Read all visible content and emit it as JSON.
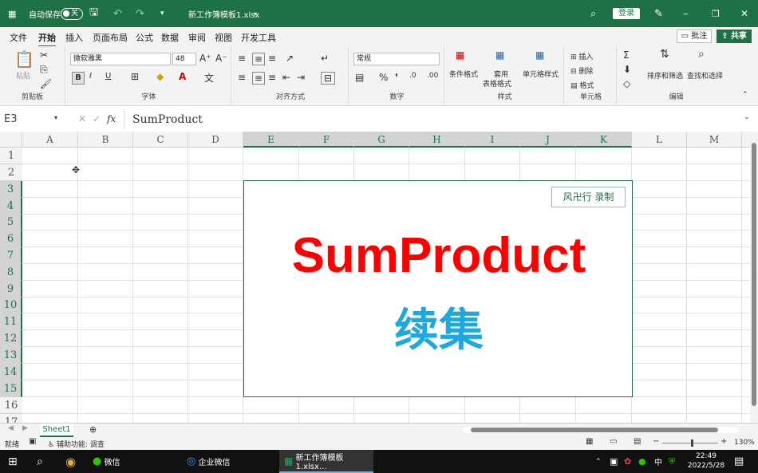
{
  "titlebar": {
    "autosave": "自动保存",
    "toggle": "关",
    "filename": "新工作簿模板1.xlsx",
    "login": "登录"
  },
  "menu": [
    "文件",
    "开始",
    "插入",
    "页面布局",
    "公式",
    "数据",
    "审阅",
    "视图",
    "开发工具"
  ],
  "comment_btn": "批注",
  "share_btn": "共享",
  "ribbon": {
    "clipboard": {
      "paste": "粘贴",
      "label": "剪贴板"
    },
    "font": {
      "name": "微软雅黑",
      "size": "48",
      "bold": "B",
      "italic": "I",
      "underline": "U",
      "label": "字体"
    },
    "align": {
      "label": "对齐方式"
    },
    "number": {
      "format": "常规",
      "label": "数字"
    },
    "styles": {
      "cond": "条件格式",
      "table1": "套用",
      "table2": "表格格式",
      "cell": "单元格样式",
      "label": "样式"
    },
    "cells": {
      "insert": "插入",
      "delete": "删除",
      "format": "格式",
      "label": "单元格"
    },
    "edit": {
      "sort": "排序和筛选",
      "find": "查找和选择",
      "label": "编辑"
    }
  },
  "formula": {
    "namebox": "E3",
    "fx": "fx",
    "value": "SumProduct"
  },
  "columns": [
    "A",
    "B",
    "C",
    "D",
    "E",
    "F",
    "G",
    "H",
    "I",
    "J",
    "K",
    "L",
    "M"
  ],
  "rows": [
    "1",
    "2",
    "3",
    "4",
    "5",
    "6",
    "7",
    "8",
    "9",
    "10",
    "11",
    "12",
    "13",
    "14",
    "15",
    "16",
    "17"
  ],
  "shape": {
    "title": "SumProduct",
    "subtitle": "续集",
    "stamp": "风卍行 录制"
  },
  "sheet": {
    "tab": "Sheet1"
  },
  "status": {
    "ready": "就绪",
    "access": "辅助功能: 调查",
    "zoom": "130%"
  },
  "taskbar": {
    "wechat": "微信",
    "wework": "企业微信",
    "excel": "新工作簿模板1.xlsx...",
    "time": "22:49",
    "date": "2022/5/28",
    "ime": "中"
  },
  "colors": {
    "green": "#1e7145",
    "red": "#ff0000",
    "blue": "#1ea8e0"
  }
}
